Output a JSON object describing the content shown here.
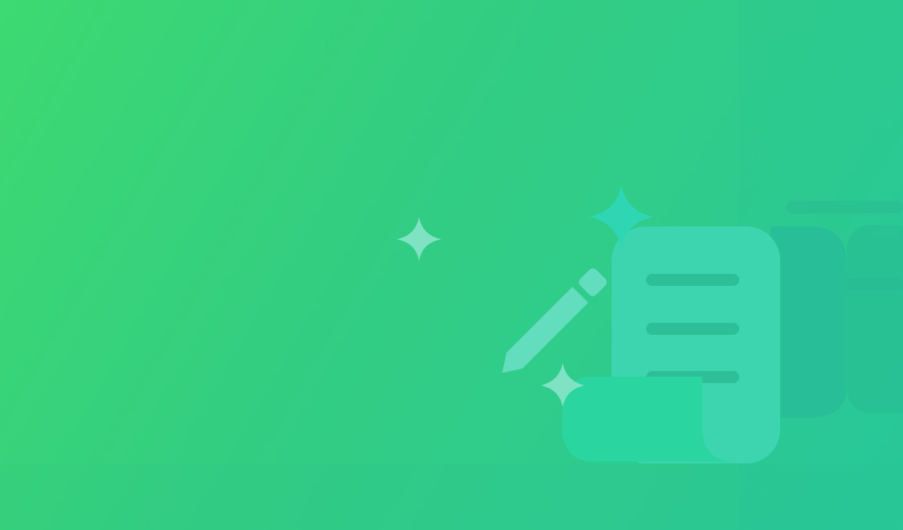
{
  "colors": {
    "bg_start": "#3dd971",
    "bg_end": "#2ac99a",
    "scroll_face": "#3cd5b0",
    "scroll_side": "#28bf98",
    "scroll_bottom": "#2bd59f",
    "pencil": "#62ddbd",
    "sparkle_teal": "#2fd6b4",
    "sparkle_light": "#7fe3c3"
  },
  "icons": {
    "hero": "document-scroll-icon",
    "pencil": "pencil-icon",
    "sparkles": [
      "sparkle-icon",
      "sparkle-icon",
      "sparkle-icon"
    ]
  }
}
